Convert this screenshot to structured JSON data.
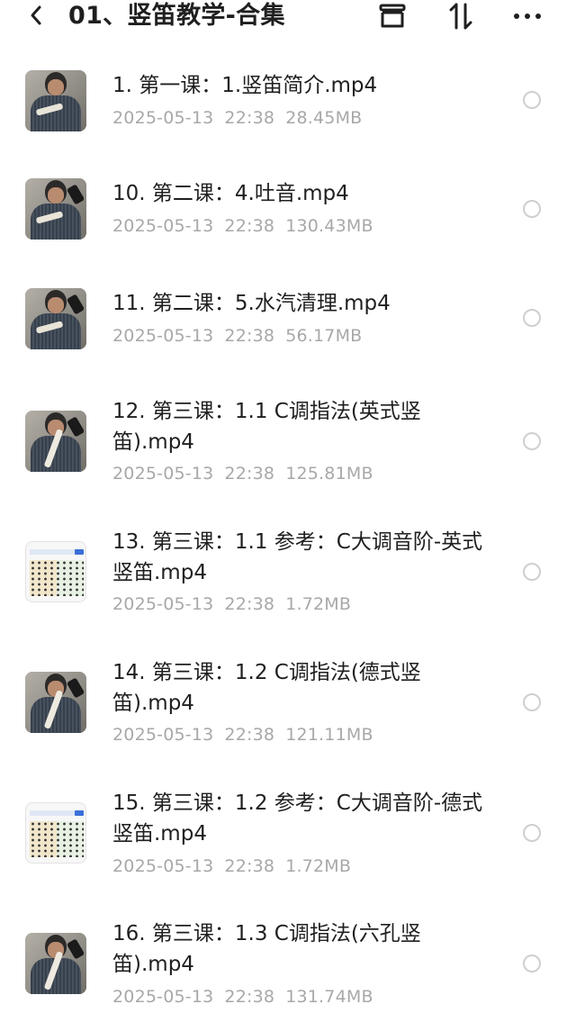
{
  "header": {
    "title": "01、竖笛教学-合集",
    "icons": [
      "back-icon",
      "archive-icon",
      "sort-icon",
      "more-icon"
    ]
  },
  "files": [
    {
      "name": "1. 第一课：1.竖笛简介.mp4",
      "date": "2025-05-13",
      "time": "22:38",
      "size": "28.45MB",
      "thumb": "person"
    },
    {
      "name": "10. 第二课：4.吐音.mp4",
      "date": "2025-05-13",
      "time": "22:38",
      "size": "130.43MB",
      "thumb": "person"
    },
    {
      "name": "11. 第二课：5.水汽清理.mp4",
      "date": "2025-05-13",
      "time": "22:38",
      "size": "56.17MB",
      "thumb": "person"
    },
    {
      "name": "12. 第三课：1.1 C调指法(英式竖笛).mp4",
      "date": "2025-05-13",
      "time": "22:38",
      "size": "125.81MB",
      "thumb": "person-flute"
    },
    {
      "name": "13. 第三课：1.1 参考：C大调音阶-英式竖笛.mp4",
      "date": "2025-05-13",
      "time": "22:38",
      "size": "1.72MB",
      "thumb": "chart"
    },
    {
      "name": "14. 第三课：1.2 C调指法(德式竖笛).mp4",
      "date": "2025-05-13",
      "time": "22:38",
      "size": "121.11MB",
      "thumb": "person-flute"
    },
    {
      "name": "15. 第三课：1.2 参考：C大调音阶-德式竖笛.mp4",
      "date": "2025-05-13",
      "time": "22:38",
      "size": "1.72MB",
      "thumb": "chart"
    },
    {
      "name": "16. 第三课：1.3 C调指法(六孔竖笛).mp4",
      "date": "2025-05-13",
      "time": "22:38",
      "size": "131.74MB",
      "thumb": "person-flute"
    }
  ]
}
